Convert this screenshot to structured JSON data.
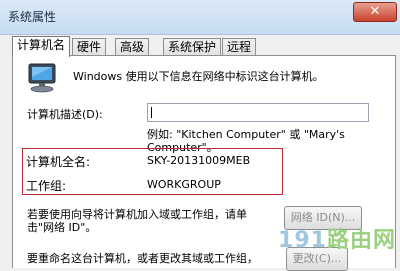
{
  "window": {
    "title": "系统属性",
    "close_glyph": "✕"
  },
  "tabs": [
    {
      "label": "计算机名",
      "active": true
    },
    {
      "label": "硬件",
      "active": false
    },
    {
      "label": "高级",
      "active": false
    },
    {
      "label": "系统保护",
      "active": false
    },
    {
      "label": "远程",
      "active": false
    }
  ],
  "panel": {
    "intro": "Windows 使用以下信息在网络中标识这台计算机。",
    "description_label": "计算机描述(D):",
    "description_value": "",
    "example_line1": "例如: \"Kitchen Computer\" 或 \"Mary's",
    "example_line2": "Computer\"。",
    "full_name_label": "计算机全名:",
    "full_name_value": "SKY-20131009MEB",
    "workgroup_label": "工作组:",
    "workgroup_value": "WORKGROUP",
    "join_text_line1": "若要使用向导将计算机加入域或工作组，请单",
    "join_text_line2": "击\"网络 ID\"。",
    "network_id_button": "网络 ID(N)...",
    "rename_text": "要重命名这台计算机，或者更改其域或工作组，",
    "change_button": "更改(C)..."
  },
  "watermark": {
    "number": "191",
    "text": "路由网"
  },
  "icons": {
    "computer": "computer-monitor-icon"
  },
  "colors": {
    "highlight_border": "#c0282d",
    "titlebar": "#c7dcf2"
  }
}
